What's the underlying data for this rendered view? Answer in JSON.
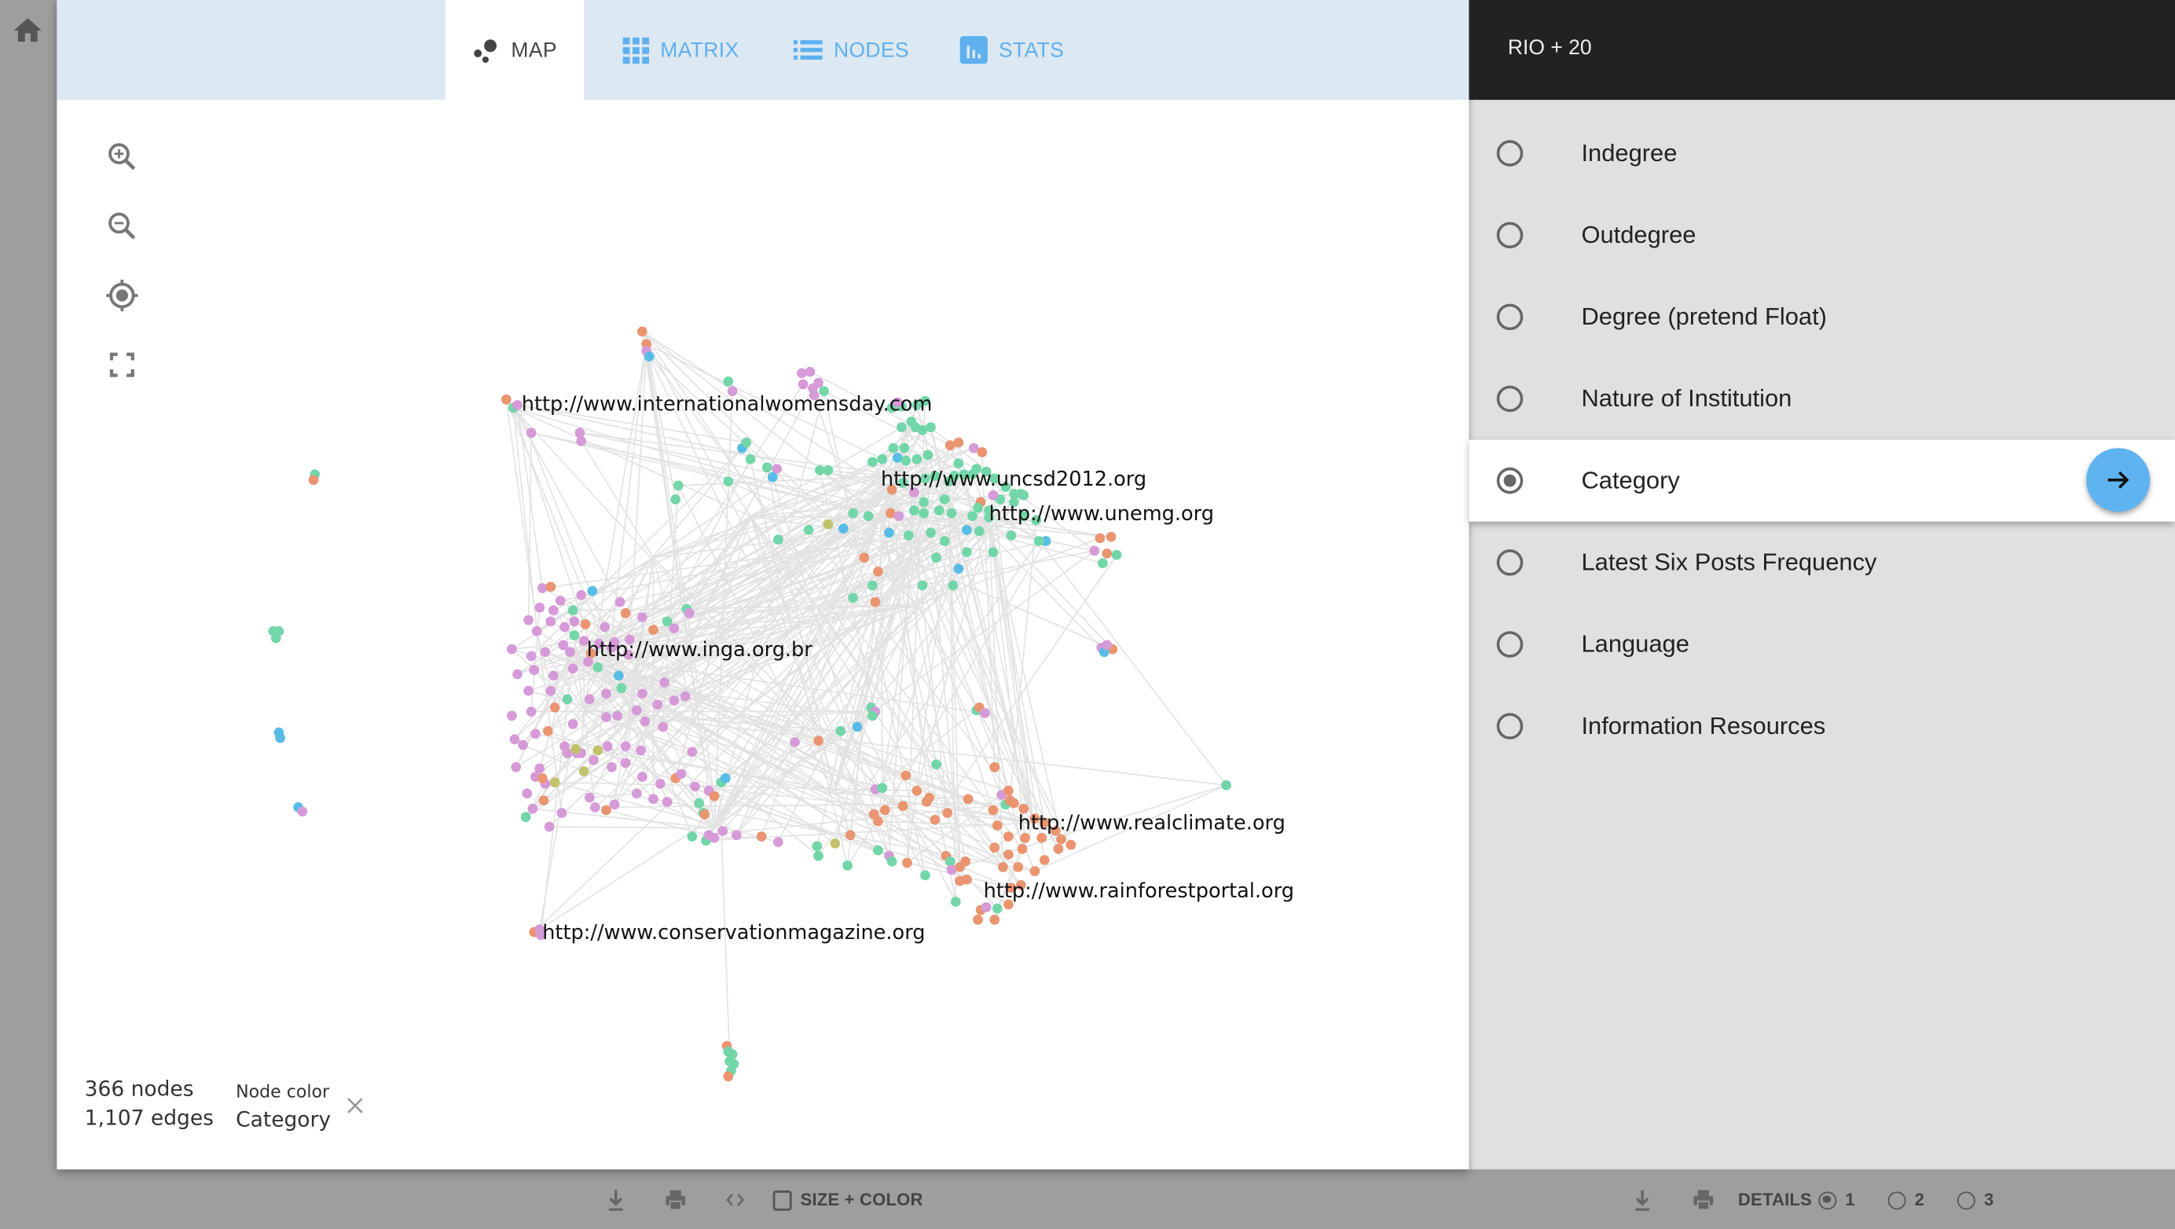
{
  "nav": {
    "home_icon": "home-icon",
    "tabs": [
      {
        "label": "MAP",
        "icon": "map-dots-icon",
        "active": true
      },
      {
        "label": "MATRIX",
        "icon": "grid-icon",
        "active": false
      },
      {
        "label": "NODES",
        "icon": "list-icon",
        "active": false
      },
      {
        "label": "STATS",
        "icon": "bar-chart-icon",
        "active": false
      }
    ]
  },
  "map_controls": [
    {
      "name": "zoom-in",
      "icon": "zoom-in-icon"
    },
    {
      "name": "zoom-out",
      "icon": "zoom-out-icon"
    },
    {
      "name": "recenter",
      "icon": "target-icon"
    },
    {
      "name": "fullscreen",
      "icon": "fullscreen-icon"
    }
  ],
  "graph": {
    "node_count": 366,
    "edge_count": 1107,
    "summary": {
      "nodes_text": "366 nodes",
      "edges_text": "1,107 edges"
    },
    "node_color": {
      "label": "Node color",
      "value": "Category"
    },
    "category_colors": {
      "purple": "#d69ad8",
      "green": "#72d6a8",
      "orange": "#ea9470",
      "blue": "#58bde6",
      "olive": "#c2c26a"
    },
    "edge_color": "#e2e2e2",
    "labels": [
      "http://www.internationalwomensday.com",
      "http://www.uncsd2012.org",
      "http://www.unemg.org",
      "http://www.inga.org.br",
      "http://www.realclimate.org",
      "http://www.rainforestportal.org",
      "http://www.conservationmagazine.org"
    ]
  },
  "panel": {
    "title": "RIO + 20",
    "options": [
      {
        "label": "Indegree",
        "selected": false
      },
      {
        "label": "Outdegree",
        "selected": false
      },
      {
        "label": "Degree (pretend Float)",
        "selected": false
      },
      {
        "label": "Nature of Institution",
        "selected": false
      },
      {
        "label": "Category",
        "selected": true
      },
      {
        "label": "Latest Six Posts Frequency",
        "selected": false
      },
      {
        "label": "Language",
        "selected": false
      },
      {
        "label": "Information Resources",
        "selected": false
      }
    ],
    "apply_icon": "arrow-right-icon",
    "accent": "#5fb3f0"
  },
  "bottom_left": {
    "size_color_label": "SIZE + COLOR",
    "size_color_checked": false
  },
  "bottom_right": {
    "details_label": "DETAILS",
    "details_options": [
      "1",
      "2",
      "3"
    ],
    "details_selected": "1"
  }
}
